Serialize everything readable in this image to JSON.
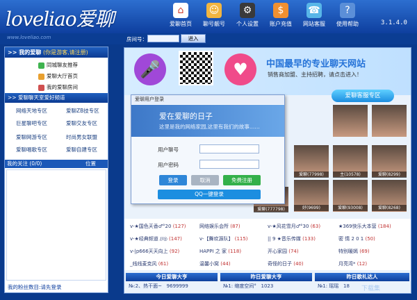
{
  "app": {
    "logo": "loveliao爱聊",
    "url": "www.loveliao.com",
    "version": "3.1.4.0"
  },
  "nav": [
    {
      "label": "爱聊首页",
      "icon": "home-icon",
      "color": "#ffffff"
    },
    {
      "label": "聊号靓号",
      "icon": "user-icon",
      "color": "#f2b540"
    },
    {
      "label": "个人设置",
      "icon": "settings-icon",
      "color": "#3a3a3a"
    },
    {
      "label": "账户充值",
      "icon": "recharge-icon",
      "color": "#f09030"
    },
    {
      "label": "网站客服",
      "icon": "support-icon",
      "color": "#58b6e8"
    },
    {
      "label": "使用帮助",
      "icon": "help-icon",
      "color": "#5b8fd8"
    }
  ],
  "roombar": {
    "label": "房间号：",
    "enter": "进入"
  },
  "left": {
    "mychat_title": ">> 我的爱聊",
    "mychat_hint": "(你是游客,请注册)",
    "menu": [
      "同城聊友推荐",
      "爱聊大厅首页",
      "我的爱聊房间"
    ],
    "channel_header": ">> 爱聊聊天室爱好频道",
    "zones": [
      "网络天地专区",
      "爱聊ZB技专区",
      "巨星聊吧专区",
      "爱聊交友专区",
      "爱聊网游专区",
      "时尚男女联盟",
      "爱聊唱歌专区",
      "爱聊自建专区"
    ],
    "follow_title": "我的关注 (0/0)",
    "follow_pos": "位置",
    "not_logged": "我的粉丝数目:请先登录"
  },
  "banner": {
    "slogan": "中国最早的专业聊天网站",
    "sub": "销售商加盟、主持招聘，请点击进入！",
    "kefu": "爱聊客服专区"
  },
  "login": {
    "header": "爱聊用户登录",
    "title": "爱在爱聊的日子",
    "subtitle": "这里是我的网络家园,这里有我们的故事……",
    "user_label": "用户聊号",
    "pass_label": "用户密码",
    "login_btn": "登录",
    "cancel_btn": "取消",
    "register_btn": "免费注册",
    "qq_btn": "QQ一键登录"
  },
  "avatars": [
    "爱聊(77998)",
    "主(10578)",
    "爱聊(8299)",
    "好(9699)",
    "爱聊(93008)",
    "爱聊(8268)",
    "爱聊(777798)",
    "爱聊(93025)",
    "聊(93008)"
  ],
  "rooms": [
    {
      "name": "v-★国色天香♂°20",
      "cnt": "(127)"
    },
    {
      "name": "网络娱乐会所",
      "cnt": "(87)"
    },
    {
      "name": "v-★风花雪月♂°30",
      "cnt": "(63)"
    },
    {
      "name": "★369快乐大本营",
      "cnt": "(184)"
    },
    {
      "name": "v-★经典频道 //◎",
      "cnt": "(147)"
    },
    {
      "name": "v-【舞欢源队】",
      "cnt": "(115)"
    },
    {
      "name": "|| 9 ★音乐传媒",
      "cnt": "(133)"
    },
    {
      "name": "密 情 2 0 1",
      "cnt": "(50)"
    },
    {
      "name": "v-|p666天天向上",
      "cnt": "(92)"
    },
    {
      "name": "HAPPI 之 家",
      "cnt": "(118)"
    },
    {
      "name": "开心家园",
      "cnt": "(74)"
    },
    {
      "name": "特别暖嫣",
      "cnt": "(69)"
    },
    {
      "name": "_线线麦克风",
      "cnt": "(61)"
    },
    {
      "name": "温馨小窝",
      "cnt": "(44)"
    },
    {
      "name": "奇怪的日子",
      "cnt": "(40)"
    },
    {
      "name": "月亮湾*",
      "cnt": "(12)"
    }
  ],
  "rankings": [
    {
      "title": "今日爱聊大亨",
      "name": "№:2、热干面~",
      "value": "9699999"
    },
    {
      "title": "昨日爱聊大亨",
      "name": "№1: 缩度空间°",
      "value": "1023"
    },
    {
      "title": "昨日歌礼达人",
      "name": "№1: 瑶瑶",
      "value": "18"
    }
  ],
  "watermark": "下载集"
}
